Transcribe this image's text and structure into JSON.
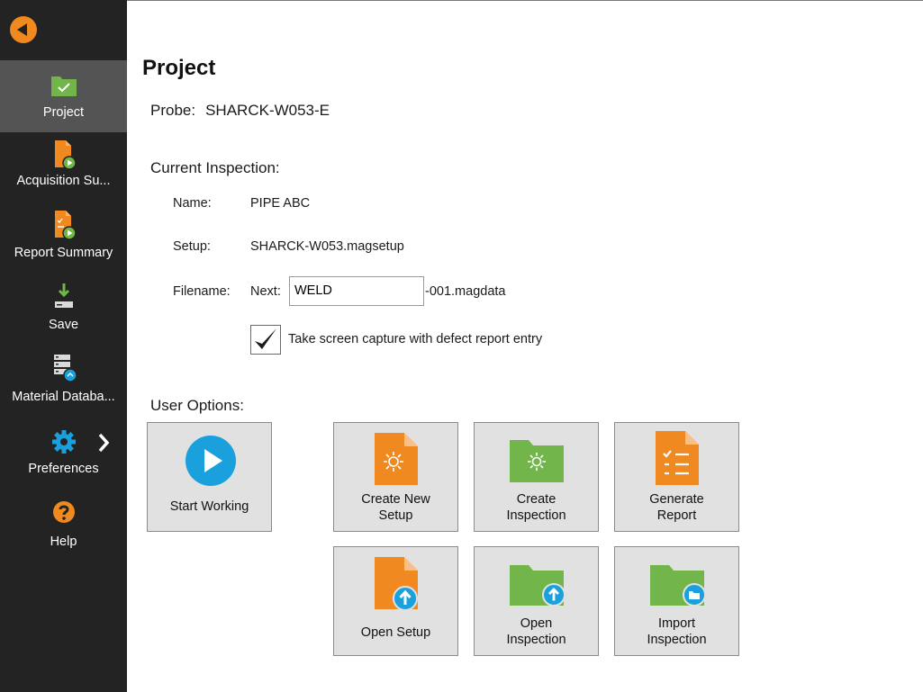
{
  "colors": {
    "sidebar_bg": "#232323",
    "sidebar_active": "#545454",
    "accent_orange": "#f0891f",
    "folder_green": "#72b54a",
    "play_blue": "#1aa0dc"
  },
  "sidebar": {
    "back_icon": "back-arrow-icon",
    "items": [
      {
        "label": "Project",
        "icon": "folder-check-icon",
        "active": true
      },
      {
        "label": "Acquisition Su...",
        "icon": "file-play-icon"
      },
      {
        "label": "Report Summary",
        "icon": "report-play-icon"
      },
      {
        "label": "Save",
        "icon": "save-download-icon"
      },
      {
        "label": "Material Databa...",
        "icon": "database-icon"
      },
      {
        "label": "Preferences",
        "icon": "gear-icon"
      },
      {
        "label": "Help",
        "icon": "help-question-icon"
      }
    ]
  },
  "main": {
    "title": "Project",
    "probe_label": "Probe:",
    "probe_value": "SHARCK-W053-E",
    "current_inspection_heading": "Current Inspection:",
    "name_label": "Name:",
    "name_value": "PIPE ABC",
    "setup_label": "Setup:",
    "setup_value": "SHARCK-W053.magsetup",
    "filename_label": "Filename:",
    "filename_next": "Next:",
    "filename_value": "WELD",
    "filename_suffix": "-001.magdata",
    "screen_capture_label": "Take screen capture with defect report entry",
    "screen_capture_checked": true,
    "user_options_heading": "User Options:"
  },
  "options": {
    "start_working": "Start Working",
    "create_new_setup": [
      "Create New",
      "Setup"
    ],
    "create_inspection": [
      "Create",
      "Inspection"
    ],
    "generate_report": [
      "Generate",
      "Report"
    ],
    "open_setup": "Open Setup",
    "open_inspection": [
      "Open",
      "Inspection"
    ],
    "import_inspection": [
      "Import",
      "Inspection"
    ]
  }
}
